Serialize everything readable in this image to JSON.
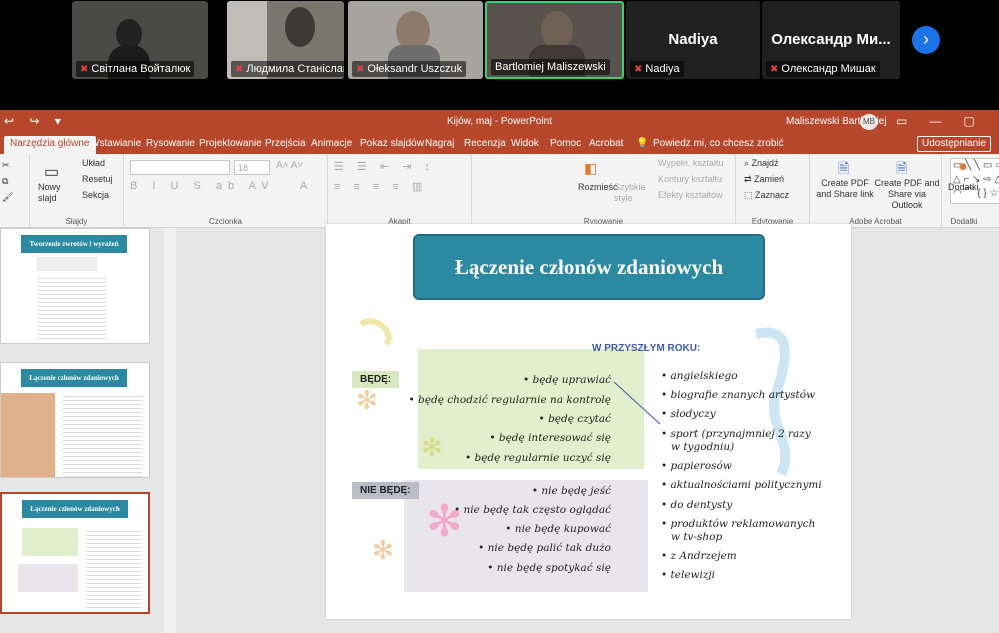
{
  "participants": [
    {
      "name": "Світлана Войталюк",
      "muted": true
    },
    {
      "name": "Людмила Станіславова",
      "muted": true
    },
    {
      "name": "Ołeksandr Uszczuk",
      "muted": true
    },
    {
      "name": "Bartlomiej Maliszewski",
      "muted": false
    },
    {
      "name": "Nadiya",
      "big": "Nadiya",
      "muted": true
    },
    {
      "name": "Олександр Мишак",
      "big": "Олександр Ми...",
      "muted": true
    }
  ],
  "window": {
    "title": "Kijów, maj  -  PowerPoint",
    "user": "Maliszewski Bartłomiej",
    "initials": "MB"
  },
  "tabs": [
    "Narzędzia główne",
    "Wstawianie",
    "Rysowanie",
    "Projektowanie",
    "Przejścia",
    "Animacje",
    "Pokaz slajdów",
    "Nagraj",
    "Recenzja",
    "Widok",
    "Pomoc",
    "Acrobat"
  ],
  "tell_me": "Powiedz mi, co chcesz zrobić",
  "share_label": "Udostępnianie",
  "ribbon": {
    "new_slide": "Nowy slajd",
    "layout": "Układ",
    "reset": "Resetuj",
    "section": "Sekcja",
    "g_slides": "Slajdy",
    "font_size": "18",
    "g_font": "Czcionka",
    "g_paragraph": "Akapit",
    "arrange": "Rozmieść",
    "quick_styles": "Szybkie style",
    "shape_fill": "Wypełn. kształtu",
    "shape_outline": "Kontury kształtu",
    "shape_effects": "Efekty kształtów",
    "g_drawing": "Rysowanie",
    "find": "Znajdź",
    "replace": "Zamień",
    "select": "Zaznacz",
    "g_editing": "Edytowanie",
    "pdf_share": "Create PDF and Share link",
    "pdf_outlook": "Create PDF and Share via Outlook",
    "g_acrobat": "Adobe Acrobat",
    "addins": "Dodatki",
    "g_addins": "Dodatki"
  },
  "thumbs": [
    "Tworzenie zwrotów i wyrażeń",
    "Łączenie członów zdaniowych",
    "Łączenie członów zdaniowych"
  ],
  "slide": {
    "title": "Łączenie członów zdaniowych",
    "header": "W PRZYSZŁYM ROKU:",
    "bede_label": "BĘDĘ:",
    "nie_label": "NIE BĘDĘ:",
    "bede": [
      "• będę uprawiać",
      "• będę chodzić regularnie na kontrolę",
      "• będę czytać",
      "• będę interesować się",
      "• będę regularnie uczyć się"
    ],
    "nie_bede": [
      "• nie będę jeść",
      "• nie będę tak często oglądać",
      "• nie będę kupować",
      "• nie będę palić tak dużo",
      "• nie będę spotykać się"
    ],
    "objects": [
      "• angielskiego",
      "• biografie znanych artystów",
      "• słodyczy",
      "• sport (przynajmniej 2 razy",
      "w tygodniu)",
      "• papierosów",
      "• aktualnościami politycznymi",
      "• do dentysty",
      "• produktów reklamowanych",
      "w tv-shop",
      "• z Andrzejem",
      "• telewizji"
    ]
  }
}
